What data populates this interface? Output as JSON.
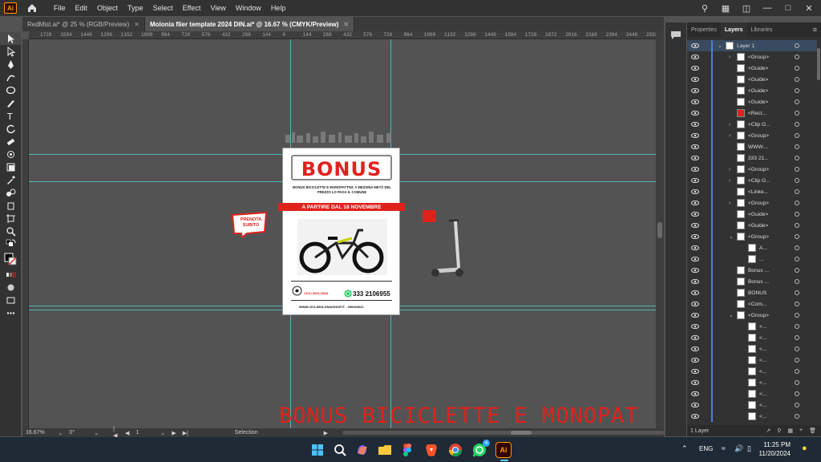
{
  "app": {
    "logo": "Ai"
  },
  "menu": [
    "File",
    "Edit",
    "Object",
    "Type",
    "Select",
    "Effect",
    "View",
    "Window",
    "Help"
  ],
  "tabs": [
    {
      "label": "RedMist.ai* @ 25 % (RGB/Preview)",
      "active": false
    },
    {
      "label": "Molonia flier template 2024 DIN.ai* @ 16.67 % (CMYK/Preview)",
      "active": true
    }
  ],
  "ruler_ticks": [
    "1728",
    "1584",
    "1440",
    "1296",
    "1152",
    "1008",
    "864",
    "720",
    "576",
    "432",
    "288",
    "144",
    "0",
    "144",
    "288",
    "432",
    "576",
    "720",
    "864",
    "1008",
    "1152",
    "1296",
    "1440",
    "1584",
    "1728",
    "1872",
    "2016",
    "2160",
    "2304",
    "2448",
    "2592"
  ],
  "artboard": {
    "headline": "BONUS",
    "subtitle": "BONUS BICICLETTE E MONOPATTINI: A MESSINA METÀ DEL PREZZO LO PAGA IL COMUNE",
    "banner": "A PARTIRE DAL 18 NOVEMBRE",
    "shop_name": "CICLI MOLONIA",
    "phone": "333 2106955",
    "website": "WWW.CICLIMOLONIASHOP.IT - 090363021"
  },
  "badge": {
    "line1": "PRENOTA",
    "line2": "SUBITO"
  },
  "overflow_text": "BONUS BICICLETTE E MONOPAT",
  "panel_tabs": [
    "Properties",
    "Layers",
    "Libraries"
  ],
  "layers": [
    {
      "name": "Layer 1",
      "indent": 0,
      "expand": "down",
      "selected": true
    },
    {
      "name": "<Group>",
      "indent": 1,
      "expand": "right"
    },
    {
      "name": "<Guide>",
      "indent": 1,
      "expand": ""
    },
    {
      "name": "<Guide>",
      "indent": 1,
      "expand": ""
    },
    {
      "name": "<Guide>",
      "indent": 1,
      "expand": ""
    },
    {
      "name": "<Guide>",
      "indent": 1,
      "expand": ""
    },
    {
      "name": "<Rect...",
      "indent": 1,
      "expand": "",
      "red": true
    },
    {
      "name": "<Clip G...",
      "indent": 1,
      "expand": "right"
    },
    {
      "name": "<Group>",
      "indent": 1,
      "expand": "right"
    },
    {
      "name": "WWW....",
      "indent": 1,
      "expand": ""
    },
    {
      "name": "333 21...",
      "indent": 1,
      "expand": ""
    },
    {
      "name": "<Group>",
      "indent": 1,
      "expand": "right"
    },
    {
      "name": "<Clip G...",
      "indent": 1,
      "expand": "right"
    },
    {
      "name": "<Linke...",
      "indent": 1,
      "expand": ""
    },
    {
      "name": "<Group>",
      "indent": 1,
      "expand": "right"
    },
    {
      "name": "<Guide>",
      "indent": 1,
      "expand": ""
    },
    {
      "name": "<Guide>",
      "indent": 1,
      "expand": ""
    },
    {
      "name": "<Group>",
      "indent": 1,
      "expand": "down"
    },
    {
      "name": "A...",
      "indent": 2,
      "expand": ""
    },
    {
      "name": "...",
      "indent": 2,
      "expand": ""
    },
    {
      "name": "Bonus ...",
      "indent": 1,
      "expand": ""
    },
    {
      "name": "Bonus ...",
      "indent": 1,
      "expand": ""
    },
    {
      "name": "BONUS",
      "indent": 1,
      "expand": ""
    },
    {
      "name": "<Com...",
      "indent": 1,
      "expand": ""
    },
    {
      "name": "<Group>",
      "indent": 1,
      "expand": "down"
    },
    {
      "name": "<...",
      "indent": 2,
      "expand": ""
    },
    {
      "name": "<...",
      "indent": 2,
      "expand": ""
    },
    {
      "name": "<...",
      "indent": 2,
      "expand": ""
    },
    {
      "name": "<...",
      "indent": 2,
      "expand": ""
    },
    {
      "name": "<...",
      "indent": 2,
      "expand": ""
    },
    {
      "name": "<...",
      "indent": 2,
      "expand": ""
    },
    {
      "name": "<...",
      "indent": 2,
      "expand": ""
    },
    {
      "name": "<...",
      "indent": 2,
      "expand": ""
    },
    {
      "name": "<...",
      "indent": 2,
      "expand": ""
    }
  ],
  "layers_footer": "1 Layer",
  "status": {
    "zoom": "16.67%",
    "rotation": "0°",
    "artboard": "1",
    "tool": "Selection"
  },
  "taskbar": {
    "lang": "ENG",
    "time": "11:25 PM",
    "date": "11/20/2024",
    "whatsapp_badge": "4",
    "ai_label": "Ai"
  }
}
